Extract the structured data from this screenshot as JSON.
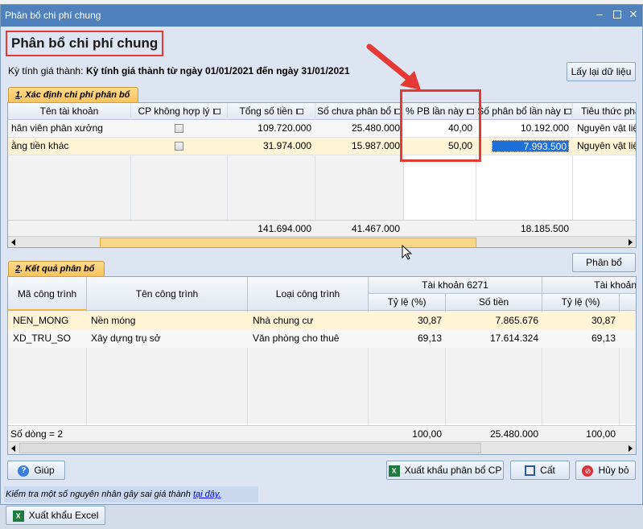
{
  "window": {
    "title": "Phân bổ chi phí chung"
  },
  "header": {
    "title": "Phân bổ chi phí chung",
    "period_label": "Kỳ tính giá thành:",
    "period_value": "Kỳ tính giá thành từ ngày 01/01/2021 đến ngày 31/01/2021",
    "reload_button": "Lấy lại dữ liệu"
  },
  "tab1": {
    "number": "1",
    "label": ". Xác định chi phí phân bổ"
  },
  "grid1": {
    "columns": [
      "Tên tài khoản",
      "CP không hợp lý",
      "Tổng số tiền",
      "Số chưa phân bổ",
      "% PB lần này",
      "Số phân bổ lần này",
      "Tiêu thức phâ"
    ],
    "rows": [
      {
        "account": "hân viên phân xưởng",
        "total": "109.720.000",
        "unallocated": "25.480.000",
        "pct": "40,00",
        "amount": "10.192.000",
        "criteria": "Nguyên vật liệ"
      },
      {
        "account": "ằng tiền khác",
        "total": "31.974.000",
        "unallocated": "15.987.000",
        "pct": "50,00",
        "amount": "7.993.500",
        "criteria": "Nguyên vật liệ"
      }
    ],
    "totals": {
      "total": "141.694.000",
      "unallocated": "41.467.000",
      "amount": "18.185.500"
    }
  },
  "allocate_button": "Phân bổ",
  "tab2": {
    "number": "2",
    "label": ". Kết quả phân bổ"
  },
  "grid2": {
    "columns": {
      "code": "Mã công trình",
      "name": "Tên công trình",
      "type": "Loại công trình",
      "group1": "Tài khoản 6271",
      "group2": "Tài khoản",
      "ratio": "Tỷ lệ (%)",
      "amount": "Số tiền"
    },
    "rows": [
      {
        "code": "NEN_MONG",
        "name": "Nền móng",
        "type": "Nhà chung cư",
        "ratio": "30,87",
        "amount": "7.865.676",
        "ratio2": "30,87"
      },
      {
        "code": "XD_TRU_SO",
        "name": "Xây dựng trụ sở",
        "type": "Văn phòng cho thuê",
        "ratio": "69,13",
        "amount": "17.614.324",
        "ratio2": "69,13"
      }
    ],
    "footer": {
      "row_count": "Số dòng = 2",
      "ratio": "100,00",
      "amount": "25.480.000",
      "ratio2": "100,00"
    }
  },
  "buttons": {
    "help": "Giúp",
    "export_allocation": "Xuất khẩu phân bổ CP",
    "save": "Cất",
    "cancel": "Hủy bỏ",
    "export_excel": "Xuất khẩu Excel"
  },
  "status": {
    "text": "Kiểm tra một số nguyên nhân gây sai giá thành ",
    "link": "tại đây."
  },
  "colors": {
    "accent": "#4f81bd",
    "highlight_red": "#e53935",
    "selected_row": "#fff4d6",
    "selection": "#1e6fd9"
  }
}
